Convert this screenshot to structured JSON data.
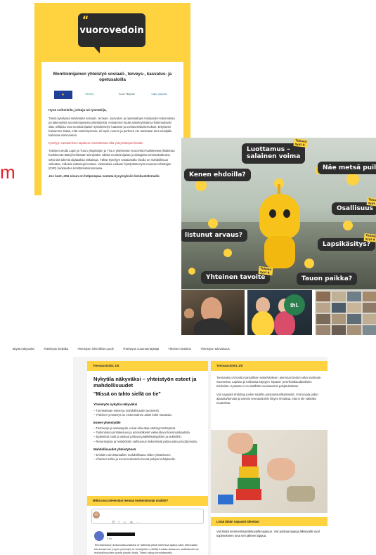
{
  "doc": {
    "logo_text": "vuorovedoin",
    "logo_quote": "“",
    "title": "Monitoimijainen yhteistyö sosiaali-, terveys-, kasvatus- ja opetusaloilla",
    "logos": [
      "European Union",
      "Ministry",
      "Turun Yliopisto",
      "Lapin yliopisto"
    ],
    "greeting": "Hyvä esihenkilö, johtaja tai työntekijä,",
    "p1": "Tässä kyselyssä selvitetään sosiaali-, terveys-, kasvatus- ja opetusalojen toimijoiden kokemuksia ja näkemyksiä monitoimijaisesta yhteistyöstä. Haluamme kuulla näkemyksiäsi ja kokemuksiasi siitä, millaisia ovat monitoimijaisen työskentelyn haasteet ja onnistumiskokemukset. Erityisesti haluamme tietää, mitä vanhempiensa, eli lapsi, nuoren ja perheen etu asetetaan aina etusijalle kaikessa toiminnassa.",
    "red_link": "Kyselyyn vastaaminen tapahtuu nimettömänä eikä yhteystietojasi kerätä.",
    "p2": "Tulosten avulla Lapin ja Turun yliopistojen ja THL:n yhteisessä Vuorovetto-hankkeessa (lisätietoa hankkeesta tästä) kehitetään toimijoiden välistä monitoimijaista ja dialogista toimintakulttuuria sekä sitä tukevia digitaalisia ratkaisuja. Tähän kyselyyn vastaamalla sinulla on mahdollisuus vaikuttaa, millaisia ratkaisuja luotaan. Vastauksia voidaan hyödyntää myös muussa rahoittajan (ESR) hankkeiden kehittämistoiminnassa.",
    "p3": "Jos koet, että sinun on helpompaa vastata kysymyksiin keskustelemalla"
  },
  "stray_letter": "m",
  "robot": {
    "bubbles": [
      {
        "text": "Luottamus –\nsalainen voima",
        "tag": "Tuhoaa\nsyyt A"
      },
      {
        "text": "Kenen ehdoilla?",
        "tag": ""
      },
      {
        "text": "Näe metsä puilta",
        "tag": ""
      },
      {
        "text": "Osallisuus",
        "tag": "Tuhoaa\nsyyt A"
      },
      {
        "text": "listunut arvaus?",
        "tag": ""
      },
      {
        "text": "Lapsikäsitys?",
        "tag": "Tuhoaa\nsyyt A"
      },
      {
        "text": "Yhteinen tavoite",
        "tag": "Tuhoaa\nsyyt A"
      },
      {
        "text": "Tauon paikka?",
        "tag": ""
      }
    ]
  },
  "thumbs": {
    "thl_badge": "thl."
  },
  "nav": {
    "items": [
      "äkyttä näkyväksi",
      "Yhteistyön kivijalka",
      "Yhteistyön inhimillinen puoli",
      "Yhteistyön suunnannäyttäjä",
      "Yhteinen keskitön",
      "Yhteistyön tulevaisuus"
    ]
  },
  "web": {
    "left": {
      "head": "Teemaosio001 1/5",
      "title": "Nykytila näkyväksi – yhteistyön esteet ja mahdollisuudet",
      "quote": "\"Missä on tahto siellä on tie\"",
      "s1": "Yhteistyön nykytila näkyväksi",
      "s1_items": "– Tunnistetaan esteet ja mahdollisuudet avoimesti.\n– Yhteinen ymmärrys on ensimmäinen askel kohti muutosta.",
      "s2": "Esteet yhteistyölle",
      "s2_items": "– Tietosuoja ja salassapito voivat aiheuttaa väärinymmärryksiä.\n– Taidonkulun pirstaleisuus ja ammattikielet vaikeuttavat kommunikaatiota.\n– Epäselvät roolit ja vastuut johtavat päällekkäisyyksiin ja aukkoihin.\n– Resurssipula ja henkilöstön vaihtuvuus heikentävät jatkuvuutta ja luottamusta.",
      "s3": "Mahdollisuudet yhteistyössä",
      "s3_items": "– Erisiden toimintamallien mahdollistava niiden yhtämiseen.\n– Yhteinen tahto ja avoin keskustelu luovat pohjan kehitykselle.",
      "q_head": "Mitkä ovat mielestäsi teeman keskeisimmät sisällöt?",
      "icons": [
        "B",
        "I",
        "☺",
        "⊕",
        "⋯"
      ],
      "reply_time": "3 kk",
      "reply": "Teemaosiollon kokonaiskuvaksesi on tärkeää pitää mielessä ajatus siitä, että kaikki toiminnamme (myös yhteistyö eri toimijoiden välillä) tuottaa lisäarvoa osallistuvile tai mahdollisuuden saada jotakin lisää. Tämä näkyy tunnistamalla"
    },
    "right": {
      "head": "Teemaosio001 1/5",
      "p1": "Teemaosio on koottu kansallisen esiselvityksen, aiemman tiedon sekä Varsinais-Suomessa, Lapissa ja Kolbassa käytyjen Topaasi- ja Erikoiskaudatuksien tuloksista. Kysassa ei on sisällöksi vuosiavainsi pohjatulostaan.",
      "p2": "Voit vapaasti ehdottaa jonkin sisällön poistamista/lisäämistä. Voit kuvata pidän ajatusta/korvata ja tuleviin teemaosioihin liittyen ilmoittaa, että ei ole välinäkö muutoksia.",
      "foot_head": "Lisää tähän vapaasti ideoitasi",
      "foot_body": "Voit lisätä kommentteja liikkuvaille lappuun. Voit poistaa lappuja liikkuvaille ovat sopimukseen oma sen jälkeen lappua."
    }
  }
}
